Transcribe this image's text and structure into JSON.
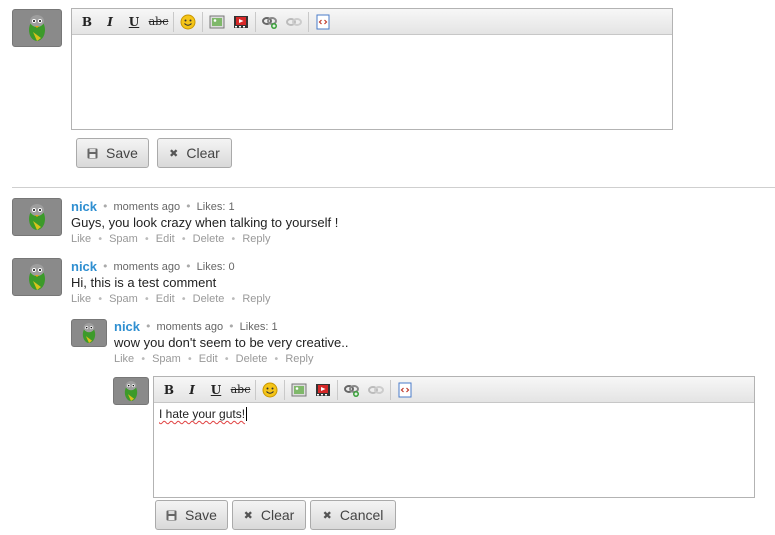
{
  "editor_top": {
    "toolbar": {
      "bold": "B",
      "italic": "I",
      "underline": "U",
      "strike": "abc",
      "icons": [
        "smiley-icon",
        "image-icon",
        "video-icon",
        "link-icon",
        "unlink-icon",
        "source-code-icon"
      ]
    },
    "content": "",
    "buttons": {
      "save": "Save",
      "clear": "Clear"
    }
  },
  "comments": [
    {
      "author": "nick",
      "time": "moments ago",
      "likes": "Likes: 1",
      "text": "Guys, you look crazy when talking to yourself !",
      "actions": [
        "Like",
        "Spam",
        "Edit",
        "Delete",
        "Reply"
      ]
    },
    {
      "author": "nick",
      "time": "moments ago",
      "likes": "Likes: 0",
      "text": "Hi, this is a test comment",
      "actions": [
        "Like",
        "Spam",
        "Edit",
        "Delete",
        "Reply"
      ]
    },
    {
      "author": "nick",
      "time": "moments ago",
      "likes": "Likes: 1",
      "text": "wow you don't seem to be very creative..",
      "actions": [
        "Like",
        "Spam",
        "Edit",
        "Delete",
        "Reply"
      ]
    }
  ],
  "editor_reply": {
    "toolbar": {
      "bold": "B",
      "italic": "I",
      "underline": "U",
      "strike": "abc"
    },
    "content": "I hate your guts!",
    "buttons": {
      "save": "Save",
      "clear": "Clear",
      "cancel": "Cancel"
    }
  }
}
